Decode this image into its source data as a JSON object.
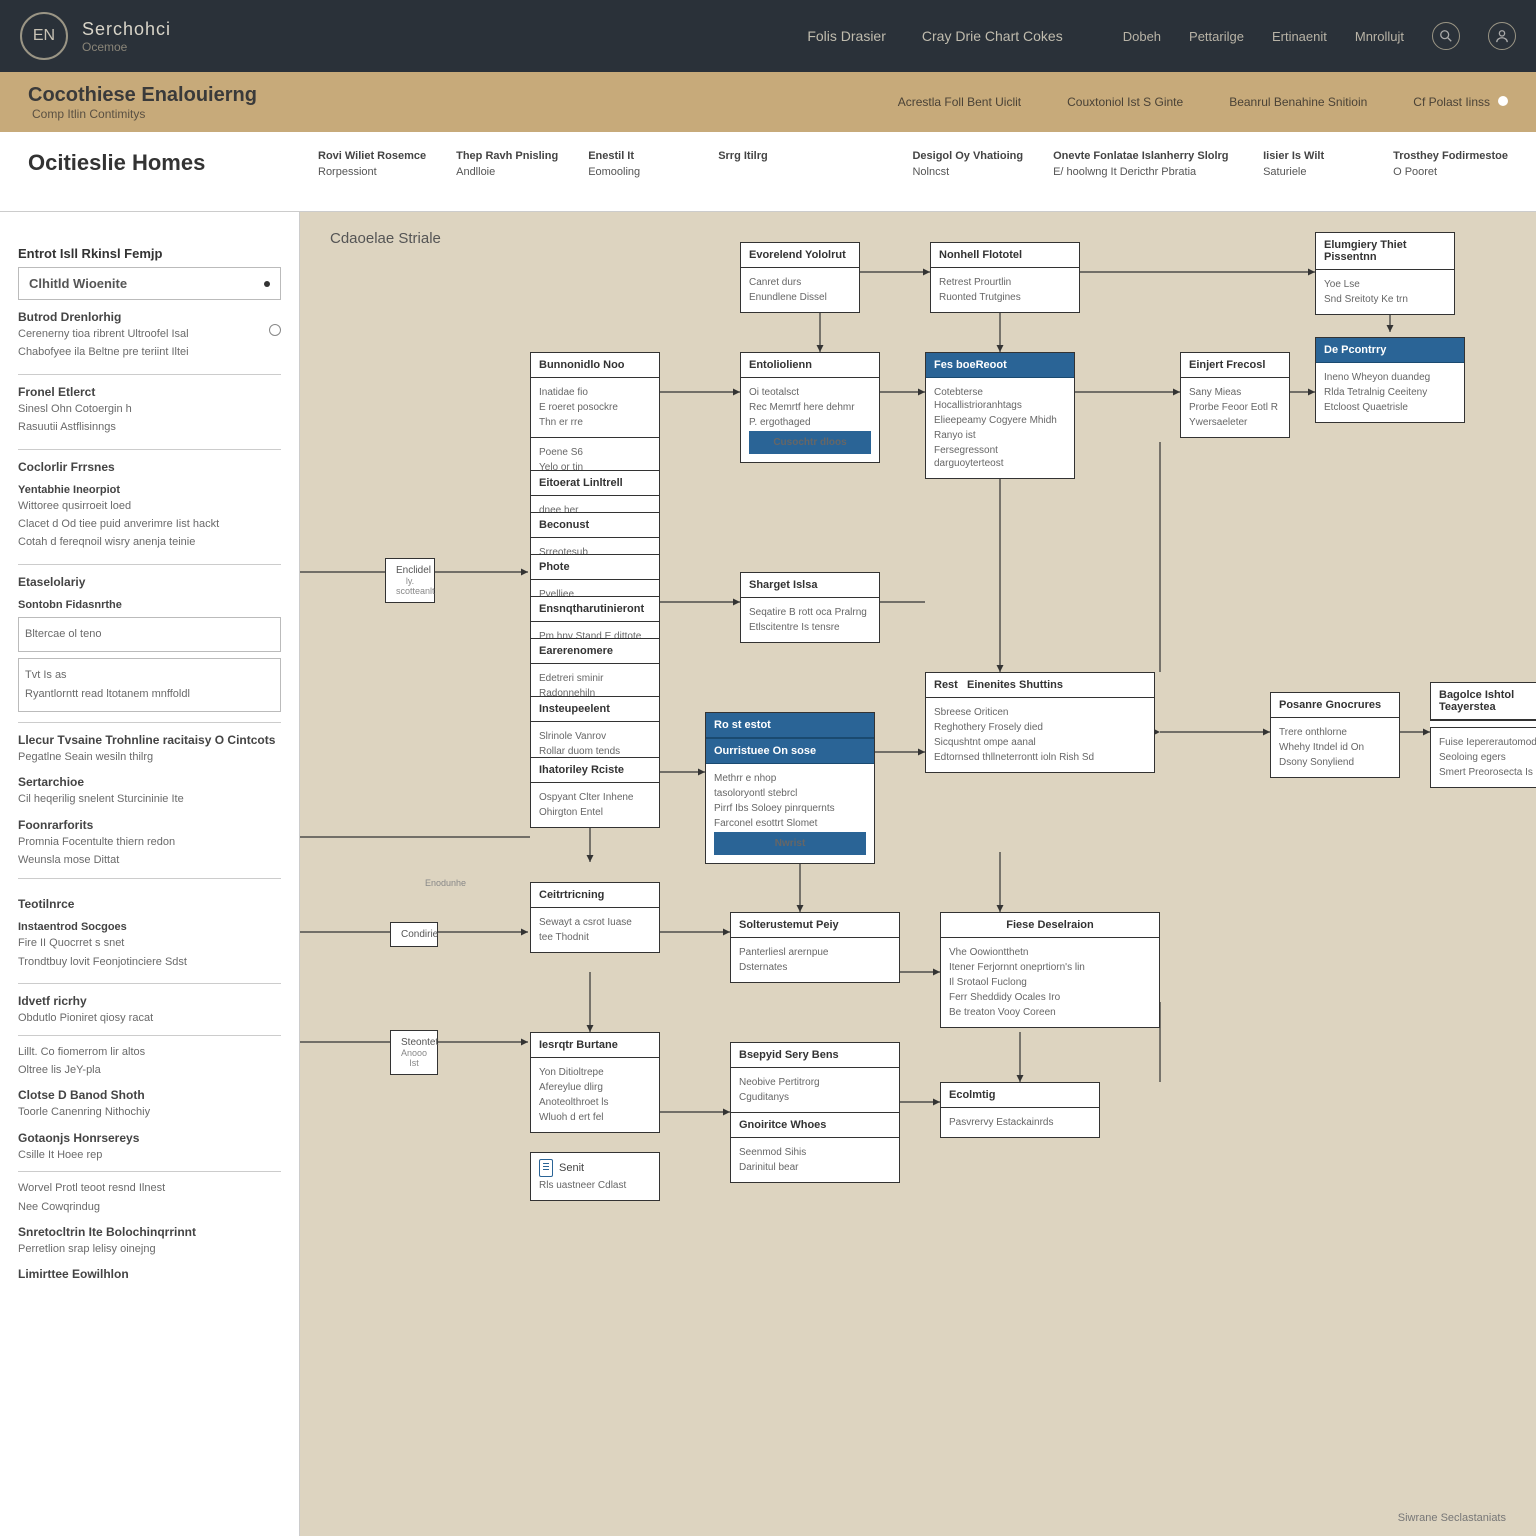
{
  "brand": {
    "logo": "EN",
    "title": "Serchohci",
    "sub": "Ocemoe"
  },
  "topnav": {
    "a": "Folis Drasier",
    "b": "Cray Drie Chart Cokes"
  },
  "toprnav": {
    "a": "Dobeh",
    "b": "Pettarilge",
    "c": "Ertinaenit",
    "d": "Mnrollujt"
  },
  "subbar": {
    "title": "Cocothiese Enalouierng",
    "sub": "Comp Itlin Contimitys",
    "n1": "Acrestla Foll Bent Uiclit",
    "n2": "Couxtoniol Ist S Ginte",
    "n3": "Beanrul Benahine Snitioin",
    "n4": "Cf Polast Iinss"
  },
  "strip": {
    "title": "Ocitieslie Homes",
    "c1": {
      "l": "Rovi Wiliet Rosemce",
      "s": "Rorpessiont"
    },
    "c2": {
      "l": "Thep Ravh Pnisling",
      "s": "Andlloie"
    },
    "c3": {
      "l": "Enestil It",
      "s": "Eomooling"
    },
    "c4": {
      "l": "Srrg Itilrg",
      "s": ""
    },
    "c5": {
      "l": "Desigol Oy Vhatioing",
      "s": "Nolncst"
    },
    "c6": {
      "l": "Onevte Fonlatae Islanherry Slolrg",
      "s": "E/ hoolwng It Dericthr Pbratia"
    },
    "c7": {
      "l": "Iisier Is Wilt",
      "s": "Saturiele"
    },
    "c8": {
      "l": "Trosthey Fodirmestoe",
      "s": "O Pooret"
    }
  },
  "sb": {
    "h0": "Entrot Isll Rkinsl Femjp",
    "row": "Clhitld Wioenite",
    "h1": "Butrod Drenlorhig",
    "l1a": "Cerenerny tioa ribrent Ultroofel Isal",
    "l1b": "Chabofyee ila Beltne pre teriint Iltei",
    "h2": "Fronel Etlerct",
    "l2a": "Sinesl Ohn Cotoergin h",
    "l2b": "Rasuutii Astflisinngs",
    "h3": "Coclorlir Frrsnes",
    "b3": "Yentabhie Ineorpiot",
    "l3a": "Wittoree qusirroeit loed",
    "l3b": "Clacet d Od tiee puid anverimre Iist hackt",
    "l3c": "Cotah d fereqnoil wisry anenja teinie",
    "h4": "Etaselolariy",
    "b4": "Sontobn Fidasnrthe",
    "box4a": "Bltercae ol teno",
    "box4b": "Tvt Is as",
    "box4c": "Ryantlorntt read ltotanem mnffoldl",
    "h5": "Llecur Tvsaine Trohnline racitaisy O Cintcots",
    "l5": "Pegatlne Seain wesiln thilrg",
    "h6": "Sertarchioe",
    "l6": "Cil heqerilig snelent Sturcininie Ite",
    "h7": "Foonrarforits",
    "l7a": "Promnia Focentulte thiern redon",
    "l7b": "Weunsla mose Dittat",
    "h8": "Teotilnrce",
    "b8": "Instaentrod Socgoes",
    "l8a": "Fire II Quocrret s snet",
    "l8b": "Trondtbuy lovit Feonjotinciere Sdst",
    "h9": "Idvetf ricrhy",
    "l9": "Obdutlo Pioniret qiosy racat",
    "l9b": "Lillt. Co fiomerrom lir altos",
    "l9c": "Oltree lis JeY-pla",
    "h10": "Clotse D Banod Shoth",
    "l10": "Toorle Canenring Nithochiy",
    "h11": "Gotaonjs Honrsereys",
    "l11": "Csille It Hoee rep",
    "l11a": "Worvel Protl teoot resnd Ilnest",
    "l11b": "Nee Cowqrindug",
    "h12": "Snretocltrin Ite Bolochinqrrinnt",
    "l12": "Perretlion srap lelisy oinejng",
    "h13": "Limirttee Eowilhlon"
  },
  "cv": {
    "title": "Cdaoelae Striale",
    "n1": {
      "h": "Evorelend Yololrut",
      "a": "Canret durs",
      "b": "Enundlene Dissel"
    },
    "n2": {
      "h": "Nonhell Flototel",
      "a": "Retrest Prourtlin",
      "b": "Ruonted Trutgines"
    },
    "n3": {
      "h": "Elumgiery Thiet Pissentnn",
      "a": "Yoe Lse",
      "b": "Snd Sreitoty Ke trn"
    },
    "n4": {
      "h": "Bunnonidlo Noo",
      "a": "Inatidae fio",
      "b": "E roeret posockre",
      "c": "Thn er rre",
      "d": "Poene S6",
      "e": "Yelo or tin"
    },
    "n4b": {
      "h": "Eitoerat Linltrell",
      "a": "dnee her"
    },
    "n4c": {
      "h": "Beconust",
      "a": "Srreotesub"
    },
    "n4d": {
      "h": "Phote",
      "a": "Pvelliee"
    },
    "n4e": {
      "h": "Ensnqtharutinieront",
      "a": "Pm hny Stand E dittote"
    },
    "n4f": {
      "h": "Earerenomere",
      "a": "Edetreri sminir",
      "b": "Radonnehiln"
    },
    "n4g": {
      "h": "Insteupeelent",
      "a": "Slrinole Vanrov",
      "b": "Rollar duom tends"
    },
    "n5": {
      "h": "Entoliolienn",
      "a": "Oi teotalsct",
      "b": "Rec Memrtf here dehmr",
      "c": "P. ergothaged",
      "btn": "Cusochtr dloos"
    },
    "n6": {
      "h": "Fes boeReoot",
      "a": "Cotebterse Hocallistrioranhtags",
      "b": "Elieepeamy Cogyere Mhidh",
      "c": "Ranyo ist",
      "d": "Fersegressont darguoyterteost"
    },
    "n7": {
      "h": "Einjert Frecosl",
      "a": "Sany Mieas",
      "b": "Prorbe Feoor Eotl R",
      "c": "Ywersaeleter"
    },
    "n8": {
      "h": "De Pcontrry",
      "a": "Ineno Wheyon duandeg",
      "b": "Rlda Tetralnig Ceeiteny",
      "c": "Etcloost Quaetrisle"
    },
    "tag1": {
      "a": "Enclidel",
      "b": "ly. scotteanlt"
    },
    "n9": {
      "h": "Sharget Islsa",
      "a": "Seqatire B rott oca Pralrng",
      "b": "Etlscitentre Is tensre"
    },
    "n10": {
      "h": "Rest",
      "h2": "Einenites Shuttins",
      "a": "Sbreese Oriticen",
      "b": "Reghothery Frosely died",
      "c": "Sicqushtnt ompe aanal",
      "d": "Edtornsed thllneterrontt ioln Rish Sd"
    },
    "n11": {
      "h": "Ro st estot",
      "h2": "Ourristuee On sose",
      "a": "Methrr e nhop",
      "b": "tasoloryontl stebrcl",
      "c": "Pirrf Ibs Soloey pinrquernts",
      "d": "Farconel esottrt Slomet",
      "btn": "Nwrist"
    },
    "n12": {
      "h": "Ihatoriley Rciste",
      "a": "Ospyant Clter Inhene",
      "b": "Ohirgton Entel"
    },
    "n13": {
      "h": "Posanre Gnocrures",
      "a": "Trere onthlorne",
      "b": "Whehy Itndel id On",
      "c": "Dsony Sonyliend"
    },
    "n14": {
      "h": "Bagolce Ishtol Teayerstea",
      "a": "Fuise Iepererautomod",
      "b": "Seoloing egers",
      "c": "Smert Preorosecta Is no"
    },
    "tag2": "Condirie",
    "n15": {
      "h": "Ceitrtricning",
      "a": "Sewayt a csrot Iuase",
      "b": "tee Thodnit"
    },
    "n16": {
      "h": "Solterustemut Peiy",
      "a": "Panterliesl arernpue",
      "b": "Dsternates"
    },
    "n17": {
      "h": "Fiese Deselraion",
      "a": "Vhe Oowiontthetn",
      "b": "Itener Ferjornnt oneprtiorn's lin",
      "c": "Il Srotaol Fuclong",
      "d": "Ferr Sheddidy Ocales Iro",
      "e": "Be treaton Vooy Coreen"
    },
    "tag3": {
      "a": "Steontet",
      "b": "Anooo Ist"
    },
    "tag4": "Enodunhe",
    "n18": {
      "h": "Iesrqtr Burtane",
      "a": "Yon Ditioltrepe",
      "b": "Afereylue dlirg",
      "c": "Anoteolthroet ls",
      "d": "Wluoh d ert fel"
    },
    "n18b": {
      "a": "Senit",
      "b": "Rls uastneer Cdlast"
    },
    "n19": {
      "h": "Bsepyid Sery Bens",
      "a": "Neobive Pertitrorg",
      "b": "Cguditanys"
    },
    "n20": {
      "h": "Gnoiritce Whoes",
      "a": "Seenmod Sihis",
      "b": "Darinitul bear"
    },
    "n21": {
      "h": "Ecolmtig",
      "a": "Pasvrervy Estackainrds"
    },
    "footer": "Siwrane Seclastaniats"
  }
}
